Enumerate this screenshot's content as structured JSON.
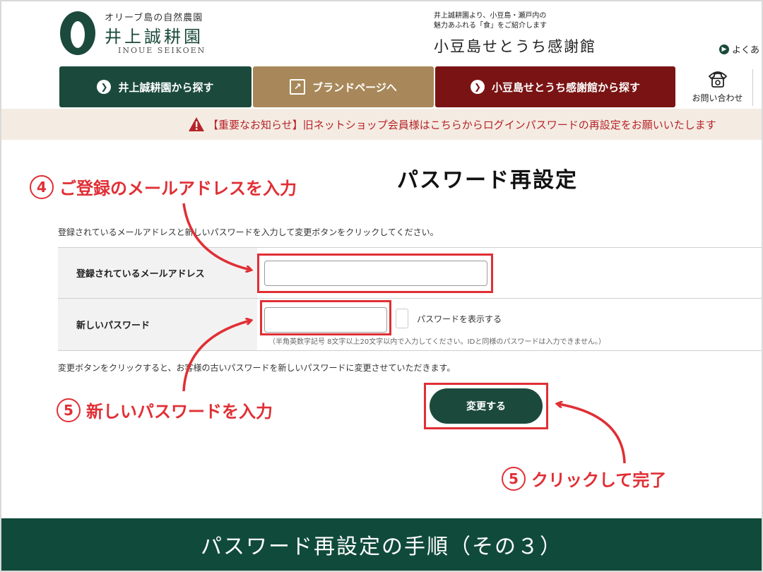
{
  "header": {
    "logo_subtitle": "オリーブ島の自然農園",
    "logo_name": "井上誠耕園",
    "logo_english": "INOUE SEIKOEN",
    "tagline_line1": "井上誠耕園より、小豆島・瀬戸内の",
    "tagline_line2": "魅力あふれる「食」をご紹介します",
    "tagline_shop": "小豆島せとうち感謝館",
    "faq_link": "よくあ"
  },
  "nav": {
    "inoue": "井上誠耕園から探す",
    "brand": "ブランドページへ",
    "shodo": "小豆島せとうち感謝館から探す",
    "contact": "お問い合わせ"
  },
  "notice": {
    "text": "【重要なお知らせ】旧ネットショップ会員様はこちらからログインパスワードの再設定をお願いいたします"
  },
  "form": {
    "title": "パスワード再設定",
    "intro": "登録されているメールアドレスと新しいパスワードを入力して変更ボタンをクリックしてください。",
    "email_label": "登録されているメールアドレス",
    "email_value": "",
    "password_label": "新しいパスワード",
    "password_value": "",
    "show_password_label": "パスワードを表示する",
    "password_hint": "（半角英数字記号 8文字以上20文字以内で入力してください。IDと同様のパスワードは入力できません。）",
    "change_note": "変更ボタンをクリックすると、お客様の古いパスワードを新しいパスワードに変更させていただきます。",
    "submit_label": "変更する"
  },
  "annotations": {
    "step4_num": "4",
    "step4_text": "ご登録のメールアドレスを入力",
    "step5a_num": "5",
    "step5a_text": "新しいパスワードを入力",
    "step5b_num": "5",
    "step5b_text": "クリックして完了",
    "color": "#e02f35"
  },
  "banner": {
    "text": "パスワード再設定の手順（その３）"
  },
  "colors": {
    "brand_green": "#1b4a3c",
    "brand_gold": "#a8885a",
    "brand_red": "#7a1414",
    "banner_green": "#104a3a"
  }
}
